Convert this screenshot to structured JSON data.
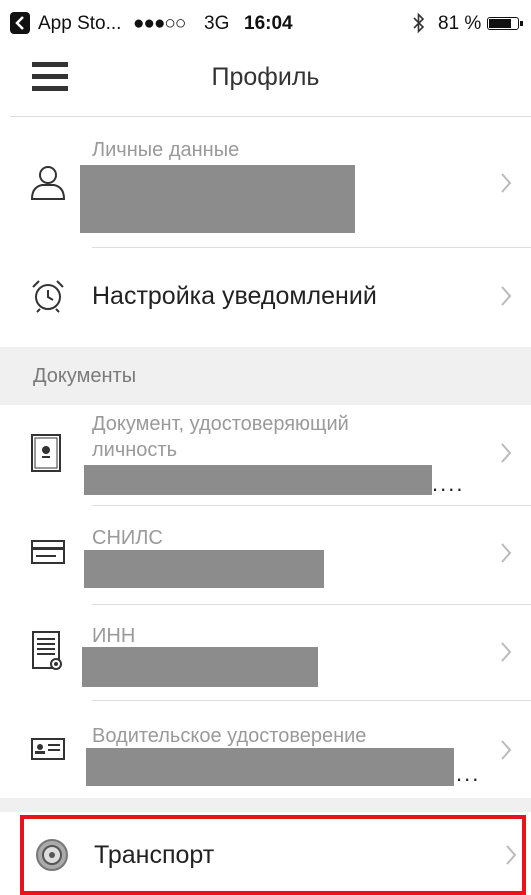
{
  "status_bar": {
    "back_app": "App Sto...",
    "signal": "●●●○○",
    "network": "3G",
    "time": "16:04",
    "battery_percent": "81 %",
    "battery_level": 0.81
  },
  "nav": {
    "title": "Профиль"
  },
  "profile": {
    "personal": {
      "label": "Личные данные"
    },
    "notifications": {
      "label": "Настройка уведомлений"
    }
  },
  "documents": {
    "section_title": "Документы",
    "items": [
      {
        "label_line1": "Документ, удостоверяющий",
        "label_line2": "личность",
        "ellipsis": "...."
      },
      {
        "label_line1": "СНИЛС"
      },
      {
        "label_line1": "ИНН"
      },
      {
        "label_line1": "Водительское удостоверение",
        "ellipsis": "..."
      }
    ]
  },
  "transport": {
    "label": "Транспорт"
  }
}
